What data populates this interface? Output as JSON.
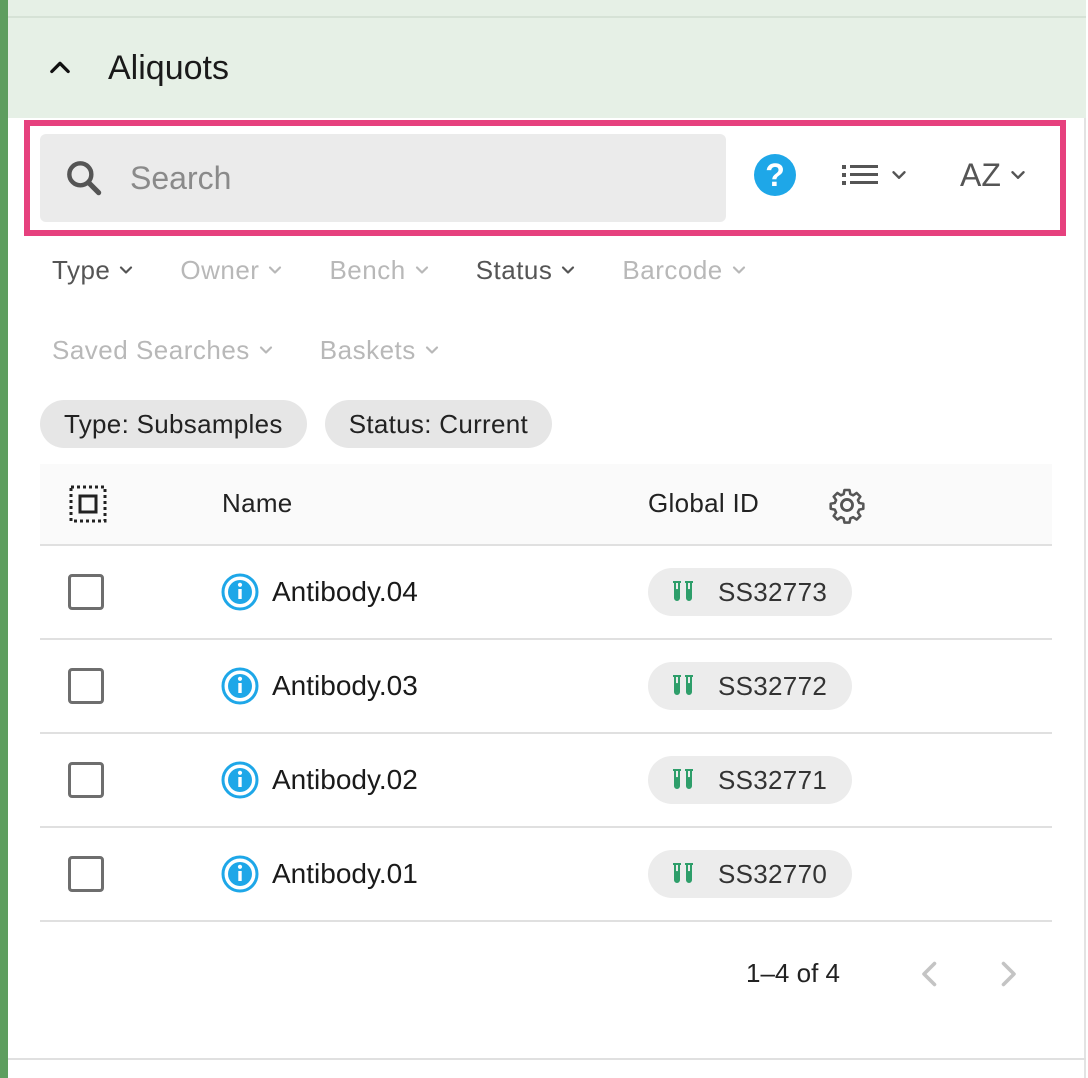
{
  "panel": {
    "title": "Aliquots"
  },
  "search": {
    "placeholder": "Search",
    "value": ""
  },
  "toolbar": {
    "help_label": "?",
    "sort_label": "AZ"
  },
  "filters": {
    "row1": [
      {
        "label": "Type",
        "active": true
      },
      {
        "label": "Owner",
        "active": false
      },
      {
        "label": "Bench",
        "active": false
      },
      {
        "label": "Status",
        "active": true
      },
      {
        "label": "Barcode",
        "active": false
      }
    ],
    "row2": [
      {
        "label": "Saved Searches",
        "active": false
      },
      {
        "label": "Baskets",
        "active": false
      }
    ]
  },
  "chips": [
    {
      "label": "Type: Subsamples"
    },
    {
      "label": "Status: Current"
    }
  ],
  "table": {
    "columns": {
      "name": "Name",
      "global_id": "Global ID"
    },
    "rows": [
      {
        "name": "Antibody.04",
        "global_id": "SS32773"
      },
      {
        "name": "Antibody.03",
        "global_id": "SS32772"
      },
      {
        "name": "Antibody.02",
        "global_id": "SS32771"
      },
      {
        "name": "Antibody.01",
        "global_id": "SS32770"
      }
    ]
  },
  "pagination": {
    "range_text": "1–4 of 4"
  },
  "colors": {
    "accent_highlight": "#e6417e",
    "header_bg": "#e6f0e6",
    "left_bar": "#5e9e5f",
    "help_blue": "#1ea7e8",
    "info_blue": "#1ea7e8",
    "subsample_green": "#2e9e6a"
  },
  "icons": {
    "collapse": "chevron-up-icon",
    "search": "search-icon",
    "help": "help-icon",
    "view": "list-view-icon",
    "select_all": "select-all-icon",
    "column_settings": "gear-icon",
    "row_info": "info-icon",
    "subsample": "test-tubes-icon",
    "prev": "chevron-left-icon",
    "next": "chevron-right-icon"
  }
}
